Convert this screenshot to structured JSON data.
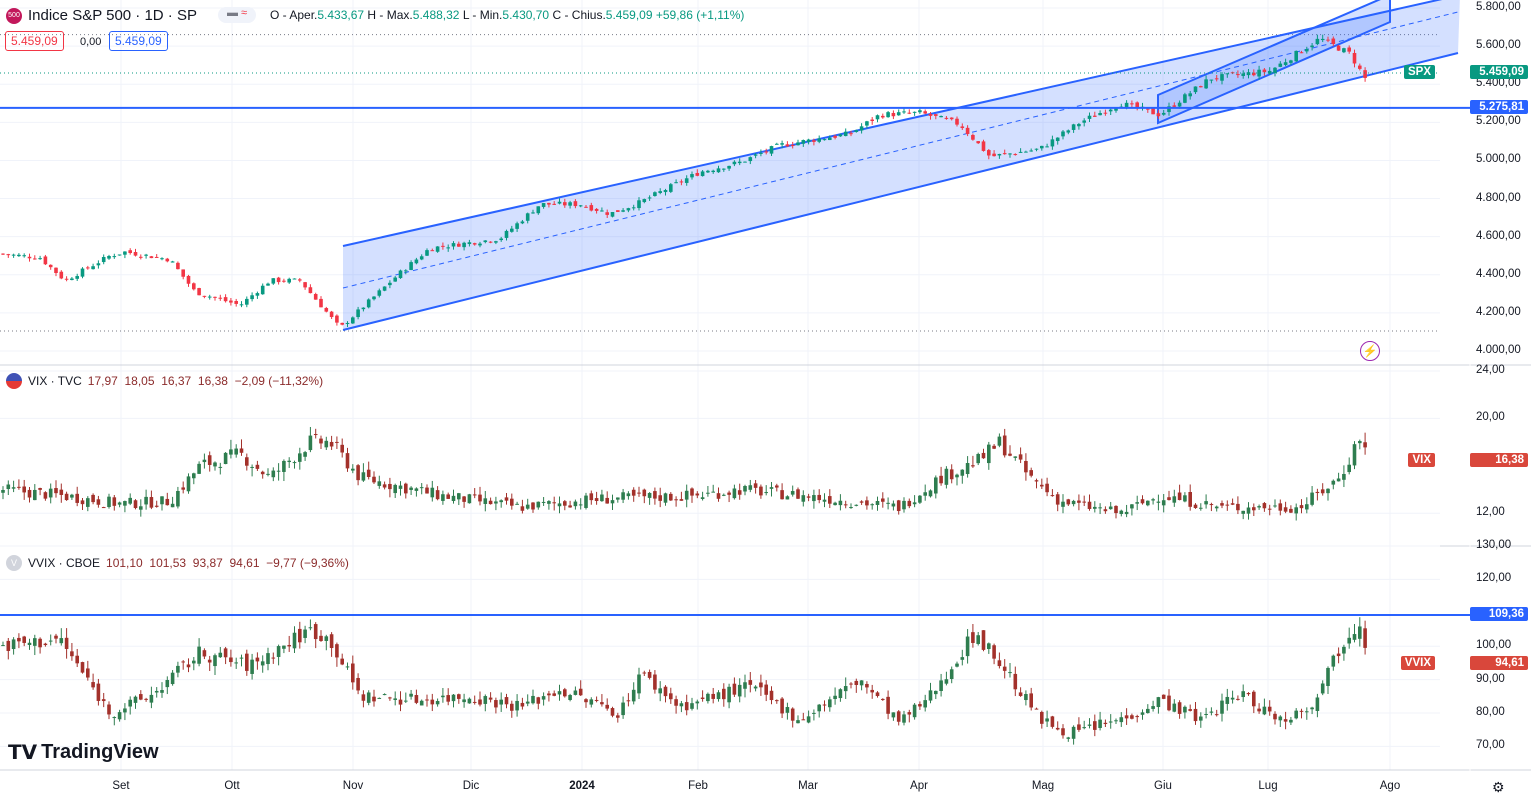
{
  "header": {
    "symbol_badge": "500",
    "title": "Indice S&P 500 · 1D · SP",
    "ohlc": {
      "o_label": "O - Aper.",
      "o": "5.433,67",
      "h_label": "H - Max.",
      "h": "5.488,32",
      "l_label": "L - Min.",
      "l": "5.430,70",
      "c_label": "C - Chius.",
      "c": "5.459,09",
      "change": "+59,86 (+1,11%)"
    },
    "sell": "5.459,09",
    "spread": "0,00",
    "buy": "5.459,09"
  },
  "vix_legend": {
    "title": "VIX · TVC",
    "values": "17,97  18,05  16,37  16,38  −2,09 (−11,32%)"
  },
  "vvix_legend": {
    "badge": "V",
    "title": "VVIX · CBOE",
    "values": "101,10  101,53  93,87  94,61  −9,77 (−9,36%)"
  },
  "logo": "TradingView",
  "colors": {
    "up": "#089981",
    "down": "#f23645",
    "line": "#2962ff",
    "channel_fill": "#2962ff"
  },
  "chart_data": [
    {
      "type": "candlestick",
      "name": "SPX",
      "ylim": [
        4000,
        5800
      ],
      "yticks": [
        "5.800,00",
        "5.600,00",
        "5.400,00",
        "5.200,00",
        "5.000,00",
        "4.800,00",
        "4.600,00",
        "4.400,00",
        "4.200,00",
        "4.000,00"
      ],
      "last_tag": {
        "label": "SPX",
        "value": "5.459,09"
      },
      "hline": {
        "value": 5275.81,
        "label": "5.275,81"
      },
      "close_path": [
        [
          0,
          4510
        ],
        [
          40,
          4490
        ],
        [
          65,
          4370
        ],
        [
          110,
          4500
        ],
        [
          125,
          4520
        ],
        [
          170,
          4480
        ],
        [
          195,
          4310
        ],
        [
          240,
          4240
        ],
        [
          270,
          4370
        ],
        [
          300,
          4370
        ],
        [
          340,
          4120
        ],
        [
          400,
          4410
        ],
        [
          430,
          4540
        ],
        [
          500,
          4590
        ],
        [
          540,
          4770
        ],
        [
          580,
          4770
        ],
        [
          610,
          4720
        ],
        [
          640,
          4780
        ],
        [
          700,
          4940
        ],
        [
          740,
          4990
        ],
        [
          780,
          5080
        ],
        [
          850,
          5140
        ],
        [
          880,
          5240
        ],
        [
          920,
          5250
        ],
        [
          960,
          5190
        ],
        [
          990,
          5020
        ],
        [
          1040,
          5060
        ],
        [
          1080,
          5200
        ],
        [
          1120,
          5300
        ],
        [
          1160,
          5240
        ],
        [
          1210,
          5430
        ],
        [
          1270,
          5470
        ],
        [
          1320,
          5640
        ],
        [
          1350,
          5560
        ],
        [
          1365,
          5430
        ],
        [
          1372,
          5459
        ]
      ]
    },
    {
      "type": "candlestick",
      "name": "VIX",
      "ylim": [
        11,
        24
      ],
      "yticks": [
        "24,00",
        "20,00",
        "12,00"
      ],
      "last_tag": {
        "label": "VIX",
        "value": "16,38"
      },
      "close_path": [
        [
          0,
          14
        ],
        [
          60,
          13.5
        ],
        [
          120,
          12.8
        ],
        [
          170,
          13
        ],
        [
          200,
          16
        ],
        [
          240,
          17
        ],
        [
          270,
          15
        ],
        [
          310,
          18
        ],
        [
          330,
          18
        ],
        [
          360,
          15
        ],
        [
          440,
          13.5
        ],
        [
          520,
          12.5
        ],
        [
          600,
          13.2
        ],
        [
          700,
          13.5
        ],
        [
          740,
          14
        ],
        [
          800,
          13.5
        ],
        [
          850,
          13
        ],
        [
          900,
          12.5
        ],
        [
          940,
          15
        ],
        [
          980,
          16.5
        ],
        [
          1000,
          18
        ],
        [
          1030,
          15
        ],
        [
          1060,
          13
        ],
        [
          1120,
          12
        ],
        [
          1160,
          13.5
        ],
        [
          1220,
          12.5
        ],
        [
          1300,
          12.5
        ],
        [
          1340,
          15
        ],
        [
          1360,
          18.5
        ],
        [
          1370,
          16.4
        ]
      ]
    },
    {
      "type": "candlestick",
      "name": "VVIX",
      "ylim": [
        65,
        130
      ],
      "yticks": [
        "130,00",
        "120,00",
        "100,00",
        "90,00",
        "80,00",
        "70,00"
      ],
      "last_tag": {
        "label": "VVIX",
        "value": "94,61"
      },
      "hline": {
        "value": 109.36,
        "label": "109,36"
      },
      "close_path": [
        [
          0,
          100
        ],
        [
          60,
          102
        ],
        [
          110,
          80
        ],
        [
          150,
          85
        ],
        [
          200,
          98
        ],
        [
          250,
          94
        ],
        [
          310,
          105
        ],
        [
          330,
          102
        ],
        [
          360,
          85
        ],
        [
          420,
          84
        ],
        [
          470,
          85
        ],
        [
          520,
          82
        ],
        [
          560,
          87
        ],
        [
          620,
          80
        ],
        [
          640,
          92
        ],
        [
          680,
          82
        ],
        [
          750,
          88
        ],
        [
          800,
          78
        ],
        [
          860,
          90
        ],
        [
          900,
          77
        ],
        [
          930,
          85
        ],
        [
          975,
          104
        ],
        [
          1000,
          95
        ],
        [
          1040,
          78
        ],
        [
          1070,
          74
        ],
        [
          1120,
          78
        ],
        [
          1160,
          84
        ],
        [
          1200,
          78
        ],
        [
          1240,
          86
        ],
        [
          1280,
          78
        ],
        [
          1310,
          82
        ],
        [
          1340,
          100
        ],
        [
          1360,
          108
        ],
        [
          1370,
          94.6
        ]
      ]
    }
  ],
  "xaxis": [
    "Set",
    "Ott",
    "Nov",
    "Dic",
    "2024",
    "Feb",
    "Mar",
    "Apr",
    "Mag",
    "Giu",
    "Lug",
    "Ago"
  ]
}
